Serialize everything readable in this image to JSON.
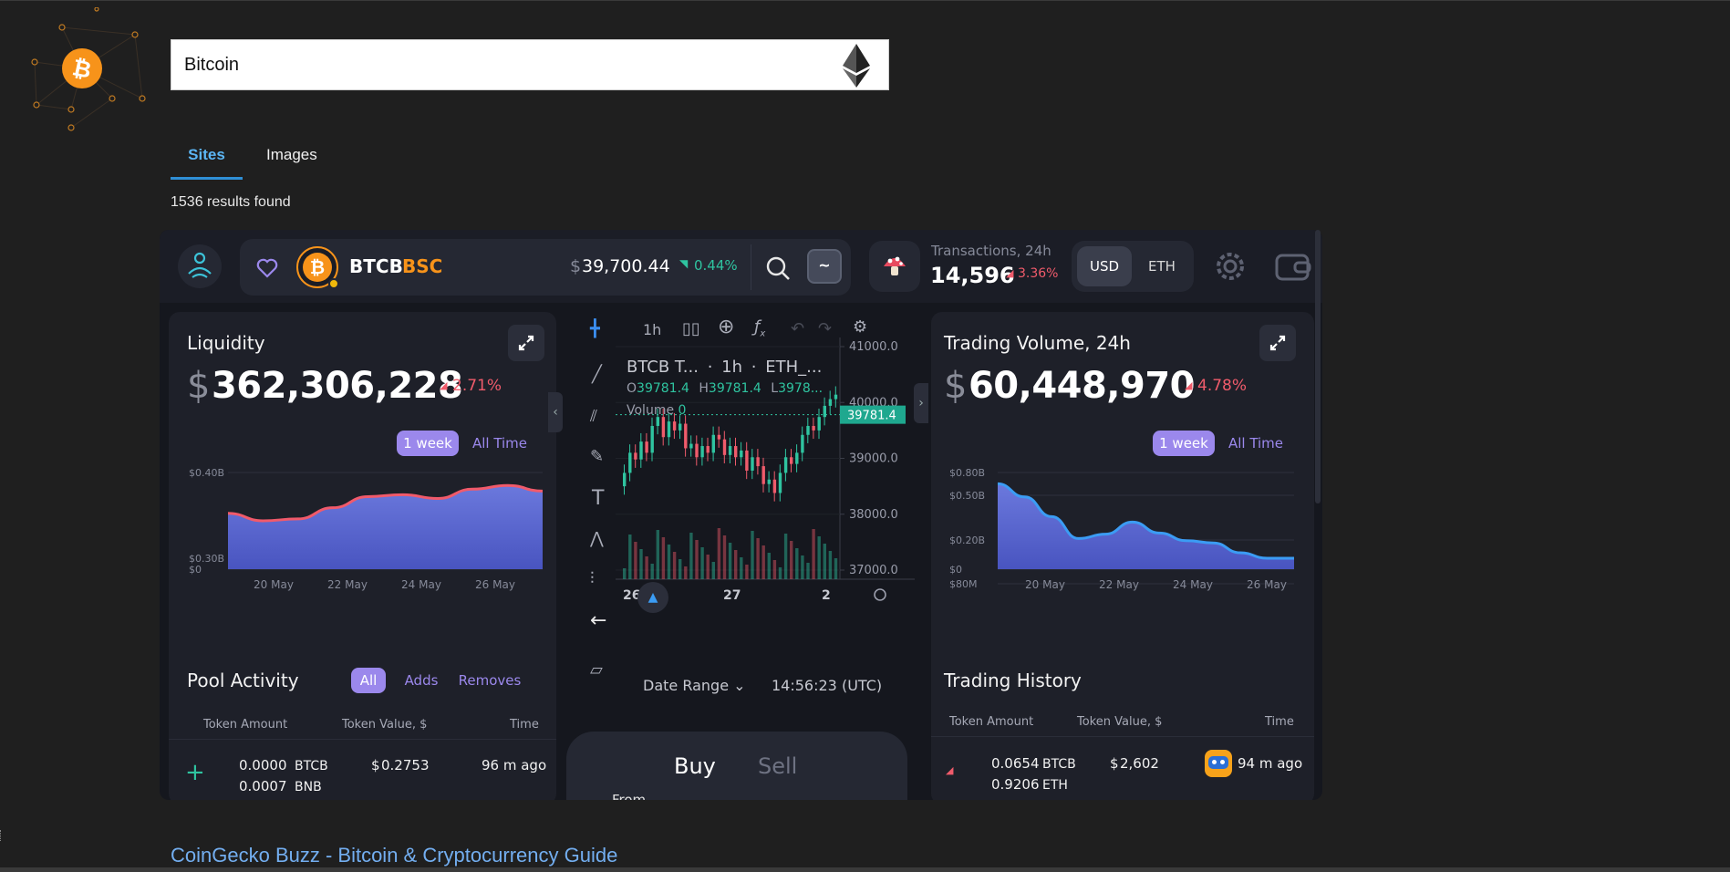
{
  "search": {
    "value": "Bitcoin"
  },
  "tabs": [
    {
      "label": "Sites"
    },
    {
      "label": "Images"
    }
  ],
  "results_text": "1536 results found",
  "widget": {
    "header": {
      "symbol": "BTCB",
      "chain": "BSC",
      "price_dollar": "$",
      "price": "39,700.44",
      "price_change": "0.44%",
      "swap_label": "~",
      "tx_label": "Transactions, 24h",
      "tx_count": "14,596",
      "tx_change": "3.36%",
      "currency_options": [
        "USD",
        "ETH"
      ]
    },
    "liquidity": {
      "title": "Liquidity",
      "dollar": "$",
      "value": "362,306,228",
      "change": "2.71%",
      "ranges": [
        "1 week",
        "All Time"
      ]
    },
    "volume": {
      "title": "Trading Volume, 24h",
      "dollar": "$",
      "value": "60,448,970",
      "change": "4.78%",
      "ranges": [
        "1 week",
        "All Time"
      ]
    },
    "pool_activity": {
      "title": "Pool Activity",
      "filters": [
        "All",
        "Adds",
        "Removes"
      ],
      "columns": [
        "Token Amount",
        "Token Value, $",
        "Time"
      ],
      "row": {
        "sign": "+",
        "amt1": "0.0000",
        "tok1": "BTCB",
        "amt2": "0.0007",
        "tok2": "BNB",
        "value_dollar": "$",
        "value": "0.2753",
        "time": "96 m ago"
      }
    },
    "trading_history": {
      "title": "Trading History",
      "columns": [
        "Token Amount",
        "Token Value, $",
        "Time"
      ],
      "row": {
        "amt1": "0.0654",
        "tok1": "BTCB",
        "amt2": "0.9206",
        "tok2": "ETH",
        "value_dollar": "$",
        "value": "2,602",
        "time": "94 m ago"
      }
    },
    "trade_chart": {
      "interval": "1h",
      "legend_title": "BTCB T...",
      "legend_interval": "1h",
      "legend_pair": "ETH_...",
      "o_label": "O",
      "o": "39781.4",
      "h_label": "H",
      "h": "39781.4",
      "l_label": "L",
      "l": "3978...",
      "volume_label": "Volume",
      "volume": "0",
      "price_ticks": [
        "41000.0",
        "40000.0",
        "39000.0",
        "38000.0",
        "37000.0"
      ],
      "last_price": "39781.4",
      "date_ticks": [
        "26",
        "27",
        "2"
      ],
      "date_range": "Date Range",
      "clock": "14:56:23 (UTC)"
    },
    "trade": {
      "buy": "Buy",
      "sell": "Sell",
      "from": "From"
    }
  },
  "chart_data": [
    {
      "type": "area",
      "x": [
        "20 May",
        "22 May",
        "24 May",
        "26 May"
      ],
      "yticks": [
        "$0.40B",
        "$0.30B",
        "$0"
      ],
      "series": [
        {
          "values": [
            0.3,
            0.26,
            0.27,
            0.33,
            0.39,
            0.4,
            0.38,
            0.43,
            0.45,
            0.42
          ]
        }
      ],
      "color": "#f15a6b"
    },
    {
      "type": "area",
      "x": [
        "20 May",
        "22 May",
        "24 May",
        "26 May"
      ],
      "yticks": [
        "$0.80B",
        "$0.50B",
        "$0.20B",
        "$80M",
        "$0"
      ],
      "series": [
        {
          "values": [
            0.78,
            0.66,
            0.48,
            0.28,
            0.32,
            0.43,
            0.33,
            0.26,
            0.24,
            0.15,
            0.1,
            0.1
          ]
        }
      ],
      "color": "#3b9cf4"
    }
  ],
  "link": {
    "text": "CoinGecko Buzz - Bitcoin & Cryptocurrency Guide"
  },
  "colors": {
    "accent_purple": "#9b88ec",
    "green": "#2fc4a0",
    "red": "#f05b6b",
    "btc_orange": "#f7931a"
  }
}
